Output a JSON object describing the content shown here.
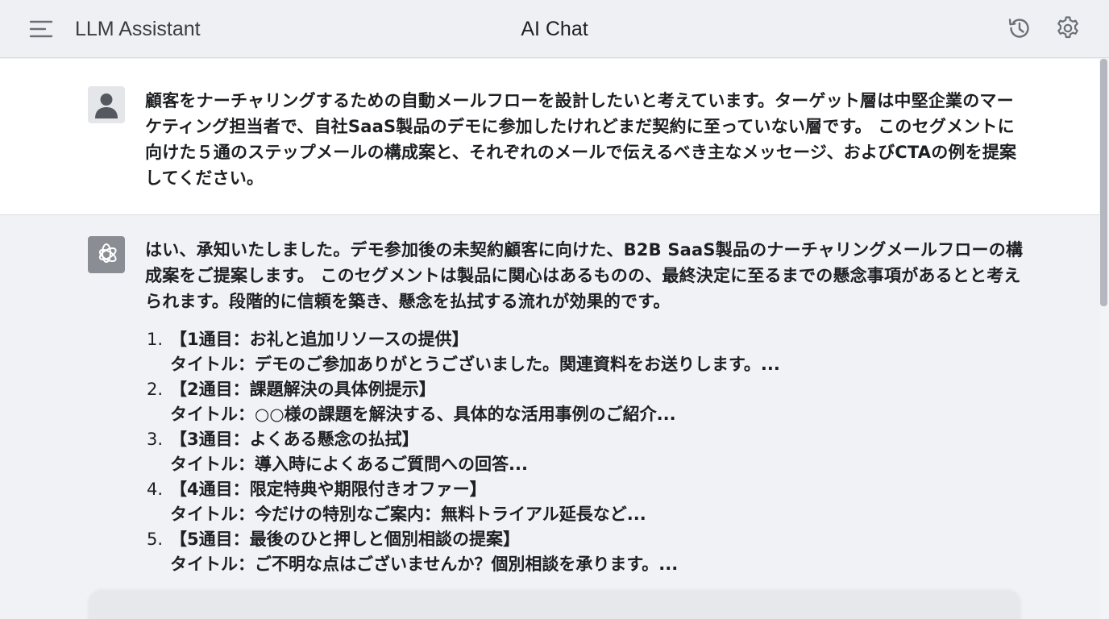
{
  "header": {
    "app_name": "LLM Assistant",
    "title": "AI Chat",
    "icons": [
      "menu-icon",
      "history-icon",
      "settings-icon"
    ]
  },
  "conversation": {
    "user_message": {
      "avatar_icon": "user-icon",
      "text": "顧客をナーチャリングするための自動メールフローを設計したいと考えています。ターゲット層は中堅企業のマーケティング担当者で、自社SaaS製品のデモに参加したけれどまだ契約に至っていない層です。 このセグメントに向けた５通のステップメールの構成案と、それぞれのメールで伝えるべき主なメッセージ、およびCTAの例を提案してください。"
    },
    "assistant_message": {
      "avatar_icon": "openai-logo-icon",
      "intro": "はい、承知いたしました。デモ参加後の未契約顧客に向けた、B2B SaaS製品のナーチャリングメールフローの構成案をご提案します。 このセグメントは製品に関心はあるものの、最終決定に至るまでの懸念事項があるとと考えられます。段階的に信頼を築き、懸念を払拭する流れが効果的です。",
      "steps": [
        {
          "number": "1.",
          "heading": "【1通目：お礼と追加リソースの提供】",
          "subject": "タイトル：デモのご参加ありがとうございました。関連資料をお送りします。..."
        },
        {
          "number": "2.",
          "heading": "【2通目：課題解決の具体例提示】",
          "subject": "タイトル：○○様の課題を解決する、具体的な活用事例のご紹介..."
        },
        {
          "number": "3.",
          "heading": "【3通目：よくある懸念の払拭】",
          "subject": "タイトル：導入時によくあるご質問への回答..."
        },
        {
          "number": "4.",
          "heading": "【4通目：限定特典や期限付きオファー】",
          "subject": "タイトル：今だけの特別なご案内：無料トライアル延長など..."
        },
        {
          "number": "5.",
          "heading": "【5通目：最後のひと押しと個別相談の提案】",
          "subject": "タイトル：ご不明な点はございませんか？個別相談を承ります。..."
        }
      ]
    }
  },
  "colors": {
    "header_bg": "#eef0f3",
    "user_bg": "#ffffff",
    "assistant_bg": "#f0f2f5",
    "bot_avatar_bg": "#8a8d93",
    "icon_color": "#5f6368"
  }
}
